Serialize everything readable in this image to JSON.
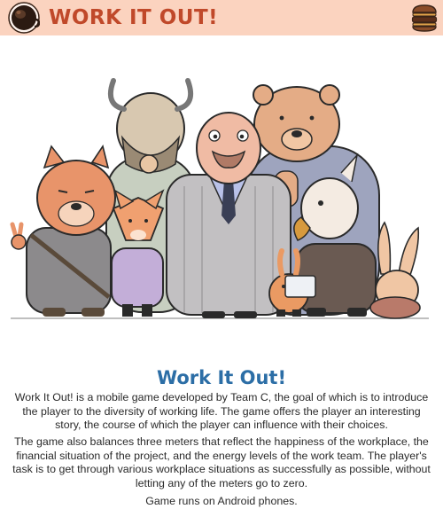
{
  "header": {
    "title": "WORK IT OUT!",
    "logo_icon": "coffee-cup-logo-icon",
    "menu_icon": "burger-menu-icon",
    "bar_color": "#fbd3bf",
    "title_color": "#c0492a"
  },
  "hero": {
    "image": "cast-of-animal-office-characters-illustration"
  },
  "content": {
    "heading": "Work It Out!",
    "heading_color": "#2c6ea6",
    "paragraphs": [
      "Work It Out! is a mobile game developed by Team C, the goal of which is to introduce the player to the diversity of working life. The game offers the player an interesting story, the course of which the player can influence with their choices.",
      "The game also balances three meters that reflect the happiness of the workplace, the financial situation of the project, and the energy levels of the work team. The player's task is to get through various workplace situations as successfully as possible, without letting any of the meters go to zero.",
      "Game runs on Android phones."
    ]
  }
}
